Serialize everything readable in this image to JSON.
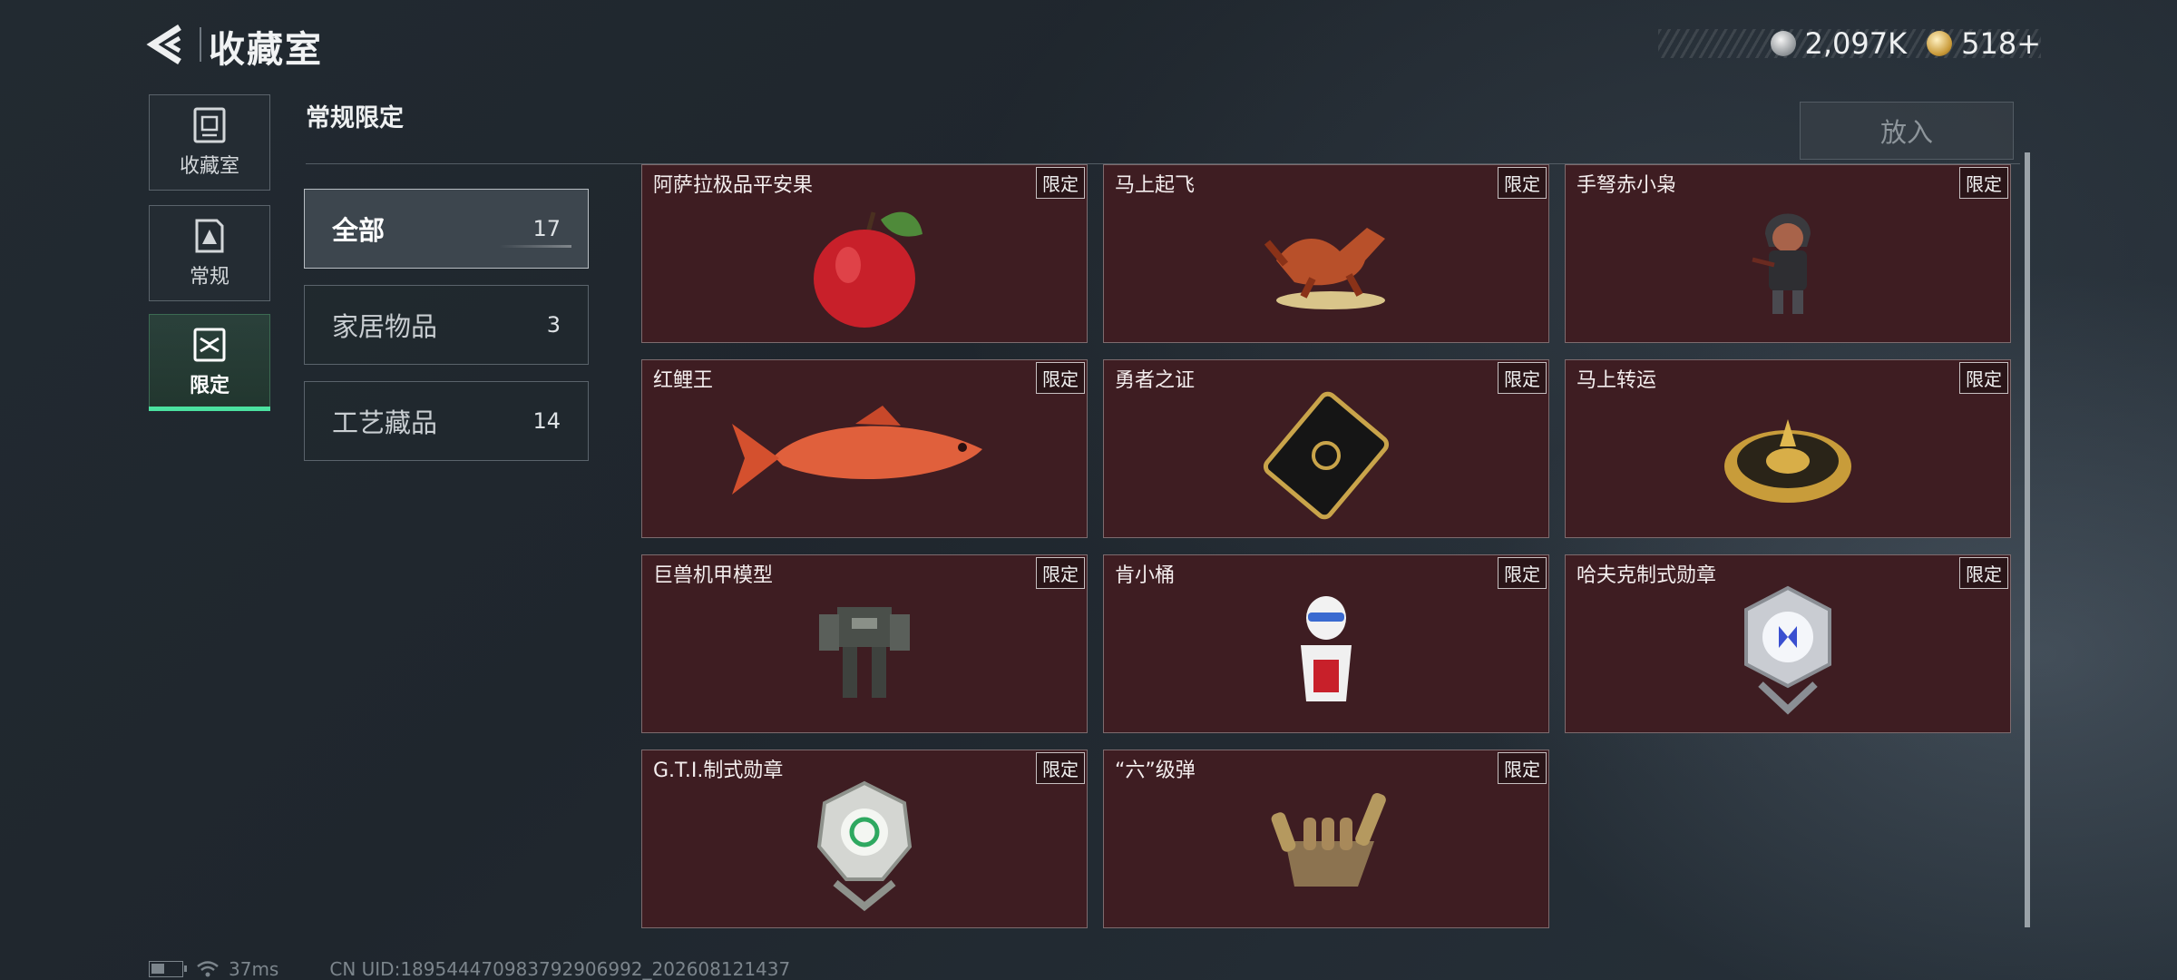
{
  "header": {
    "title": "收藏室",
    "currencies": [
      {
        "icon": "silver-coin-icon",
        "value": "2,097K"
      },
      {
        "icon": "gold-coin-icon",
        "value": "518+"
      }
    ]
  },
  "sidebar": {
    "items": [
      {
        "label": "收藏室",
        "icon": "collection-room-icon",
        "active": false
      },
      {
        "label": "常规",
        "icon": "regular-icon",
        "active": false
      },
      {
        "label": "限定",
        "icon": "limited-icon",
        "active": true
      }
    ]
  },
  "section": {
    "title": "常规限定",
    "put_in_label": "放入"
  },
  "categories": [
    {
      "label": "全部",
      "count": "17",
      "active": true
    },
    {
      "label": "家居物品",
      "count": "3",
      "active": false
    },
    {
      "label": "工艺藏品",
      "count": "14",
      "active": false
    }
  ],
  "cards": [
    {
      "name": "阿萨拉极品平安果",
      "tag": "限定",
      "art": "apple-icon"
    },
    {
      "name": "马上起飞",
      "tag": "限定",
      "art": "flying-horse-icon"
    },
    {
      "name": "手弩赤小枭",
      "tag": "限定",
      "art": "hooded-figure-icon"
    },
    {
      "name": "红鲤王",
      "tag": "限定",
      "art": "red-carp-icon"
    },
    {
      "name": "勇者之证",
      "tag": "限定",
      "art": "black-card-icon"
    },
    {
      "name": "马上转运",
      "tag": "限定",
      "art": "golden-wheel-icon"
    },
    {
      "name": "巨兽机甲模型",
      "tag": "限定",
      "art": "mech-model-icon"
    },
    {
      "name": "肯小桶",
      "tag": "限定",
      "art": "bucket-figure-icon"
    },
    {
      "name": "哈夫克制式勋章",
      "tag": "限定",
      "art": "blue-medal-icon"
    },
    {
      "name": "G.T.I.制式勋章",
      "tag": "限定",
      "art": "green-medal-icon"
    },
    {
      "name": "“六”级弹",
      "tag": "限定",
      "art": "bullet-hand-icon"
    }
  ],
  "footer": {
    "ping": "37ms",
    "uid": "CN UID:189544470983792906992_202608121437"
  },
  "colors": {
    "accent_green": "#4be2a0",
    "card_bg": "#3e1d22"
  }
}
